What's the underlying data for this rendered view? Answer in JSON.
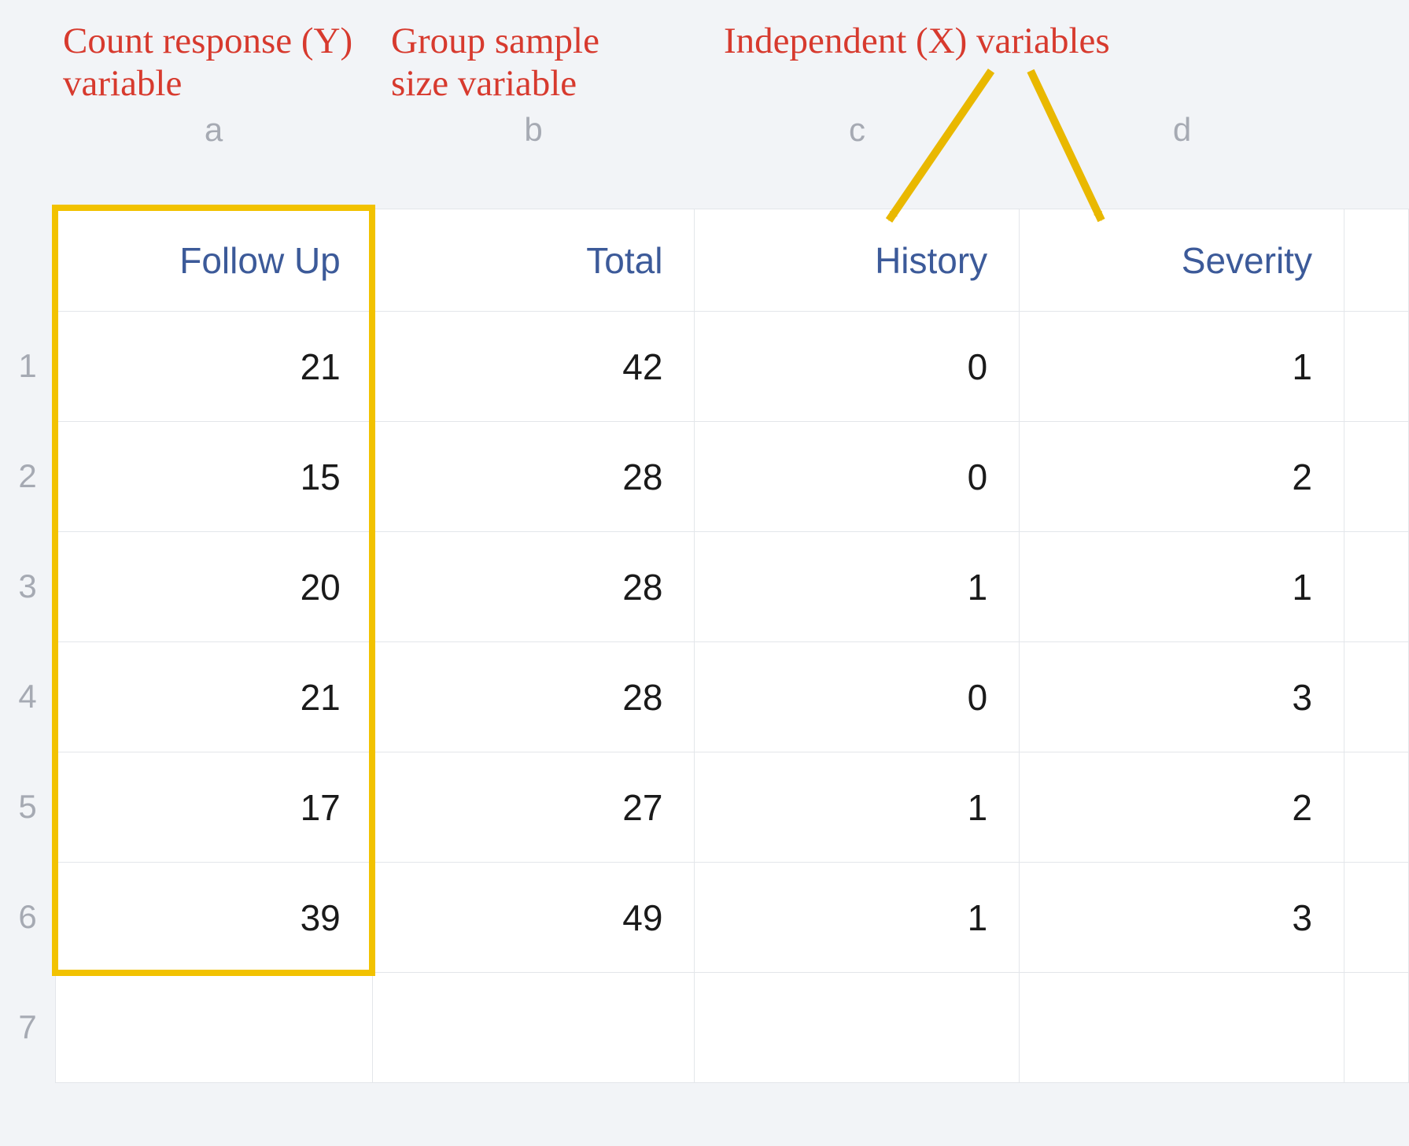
{
  "annotations": {
    "a": "Count response (Y) variable",
    "b": "Group sample size variable",
    "x": "Independent (X) variables"
  },
  "column_letters": {
    "a": "a",
    "b": "b",
    "c": "c",
    "d": "d"
  },
  "headers": {
    "follow_up": "Follow Up",
    "total": "Total",
    "history": "History",
    "severity": "Severity"
  },
  "row_numbers": [
    "1",
    "2",
    "3",
    "4",
    "5",
    "6",
    "7"
  ],
  "rows": [
    {
      "follow_up": "21",
      "total": "42",
      "history": "0",
      "severity": "1"
    },
    {
      "follow_up": "15",
      "total": "28",
      "history": "0",
      "severity": "2"
    },
    {
      "follow_up": "20",
      "total": "28",
      "history": "1",
      "severity": "1"
    },
    {
      "follow_up": "21",
      "total": "28",
      "history": "0",
      "severity": "3"
    },
    {
      "follow_up": "17",
      "total": "27",
      "history": "1",
      "severity": "2"
    },
    {
      "follow_up": "39",
      "total": "49",
      "history": "1",
      "severity": "3"
    },
    {
      "follow_up": "",
      "total": "",
      "history": "",
      "severity": ""
    }
  ],
  "chart_data": {
    "type": "table",
    "columns": [
      "Follow Up",
      "Total",
      "History",
      "Severity"
    ],
    "column_letters": [
      "a",
      "b",
      "c",
      "d"
    ],
    "column_roles": [
      "Count response (Y) variable",
      "Group sample size variable",
      "Independent (X) variable",
      "Independent (X) variable"
    ],
    "data": [
      [
        21,
        42,
        0,
        1
      ],
      [
        15,
        28,
        0,
        2
      ],
      [
        20,
        28,
        1,
        1
      ],
      [
        21,
        28,
        0,
        3
      ],
      [
        17,
        27,
        1,
        2
      ],
      [
        39,
        49,
        1,
        3
      ]
    ]
  }
}
